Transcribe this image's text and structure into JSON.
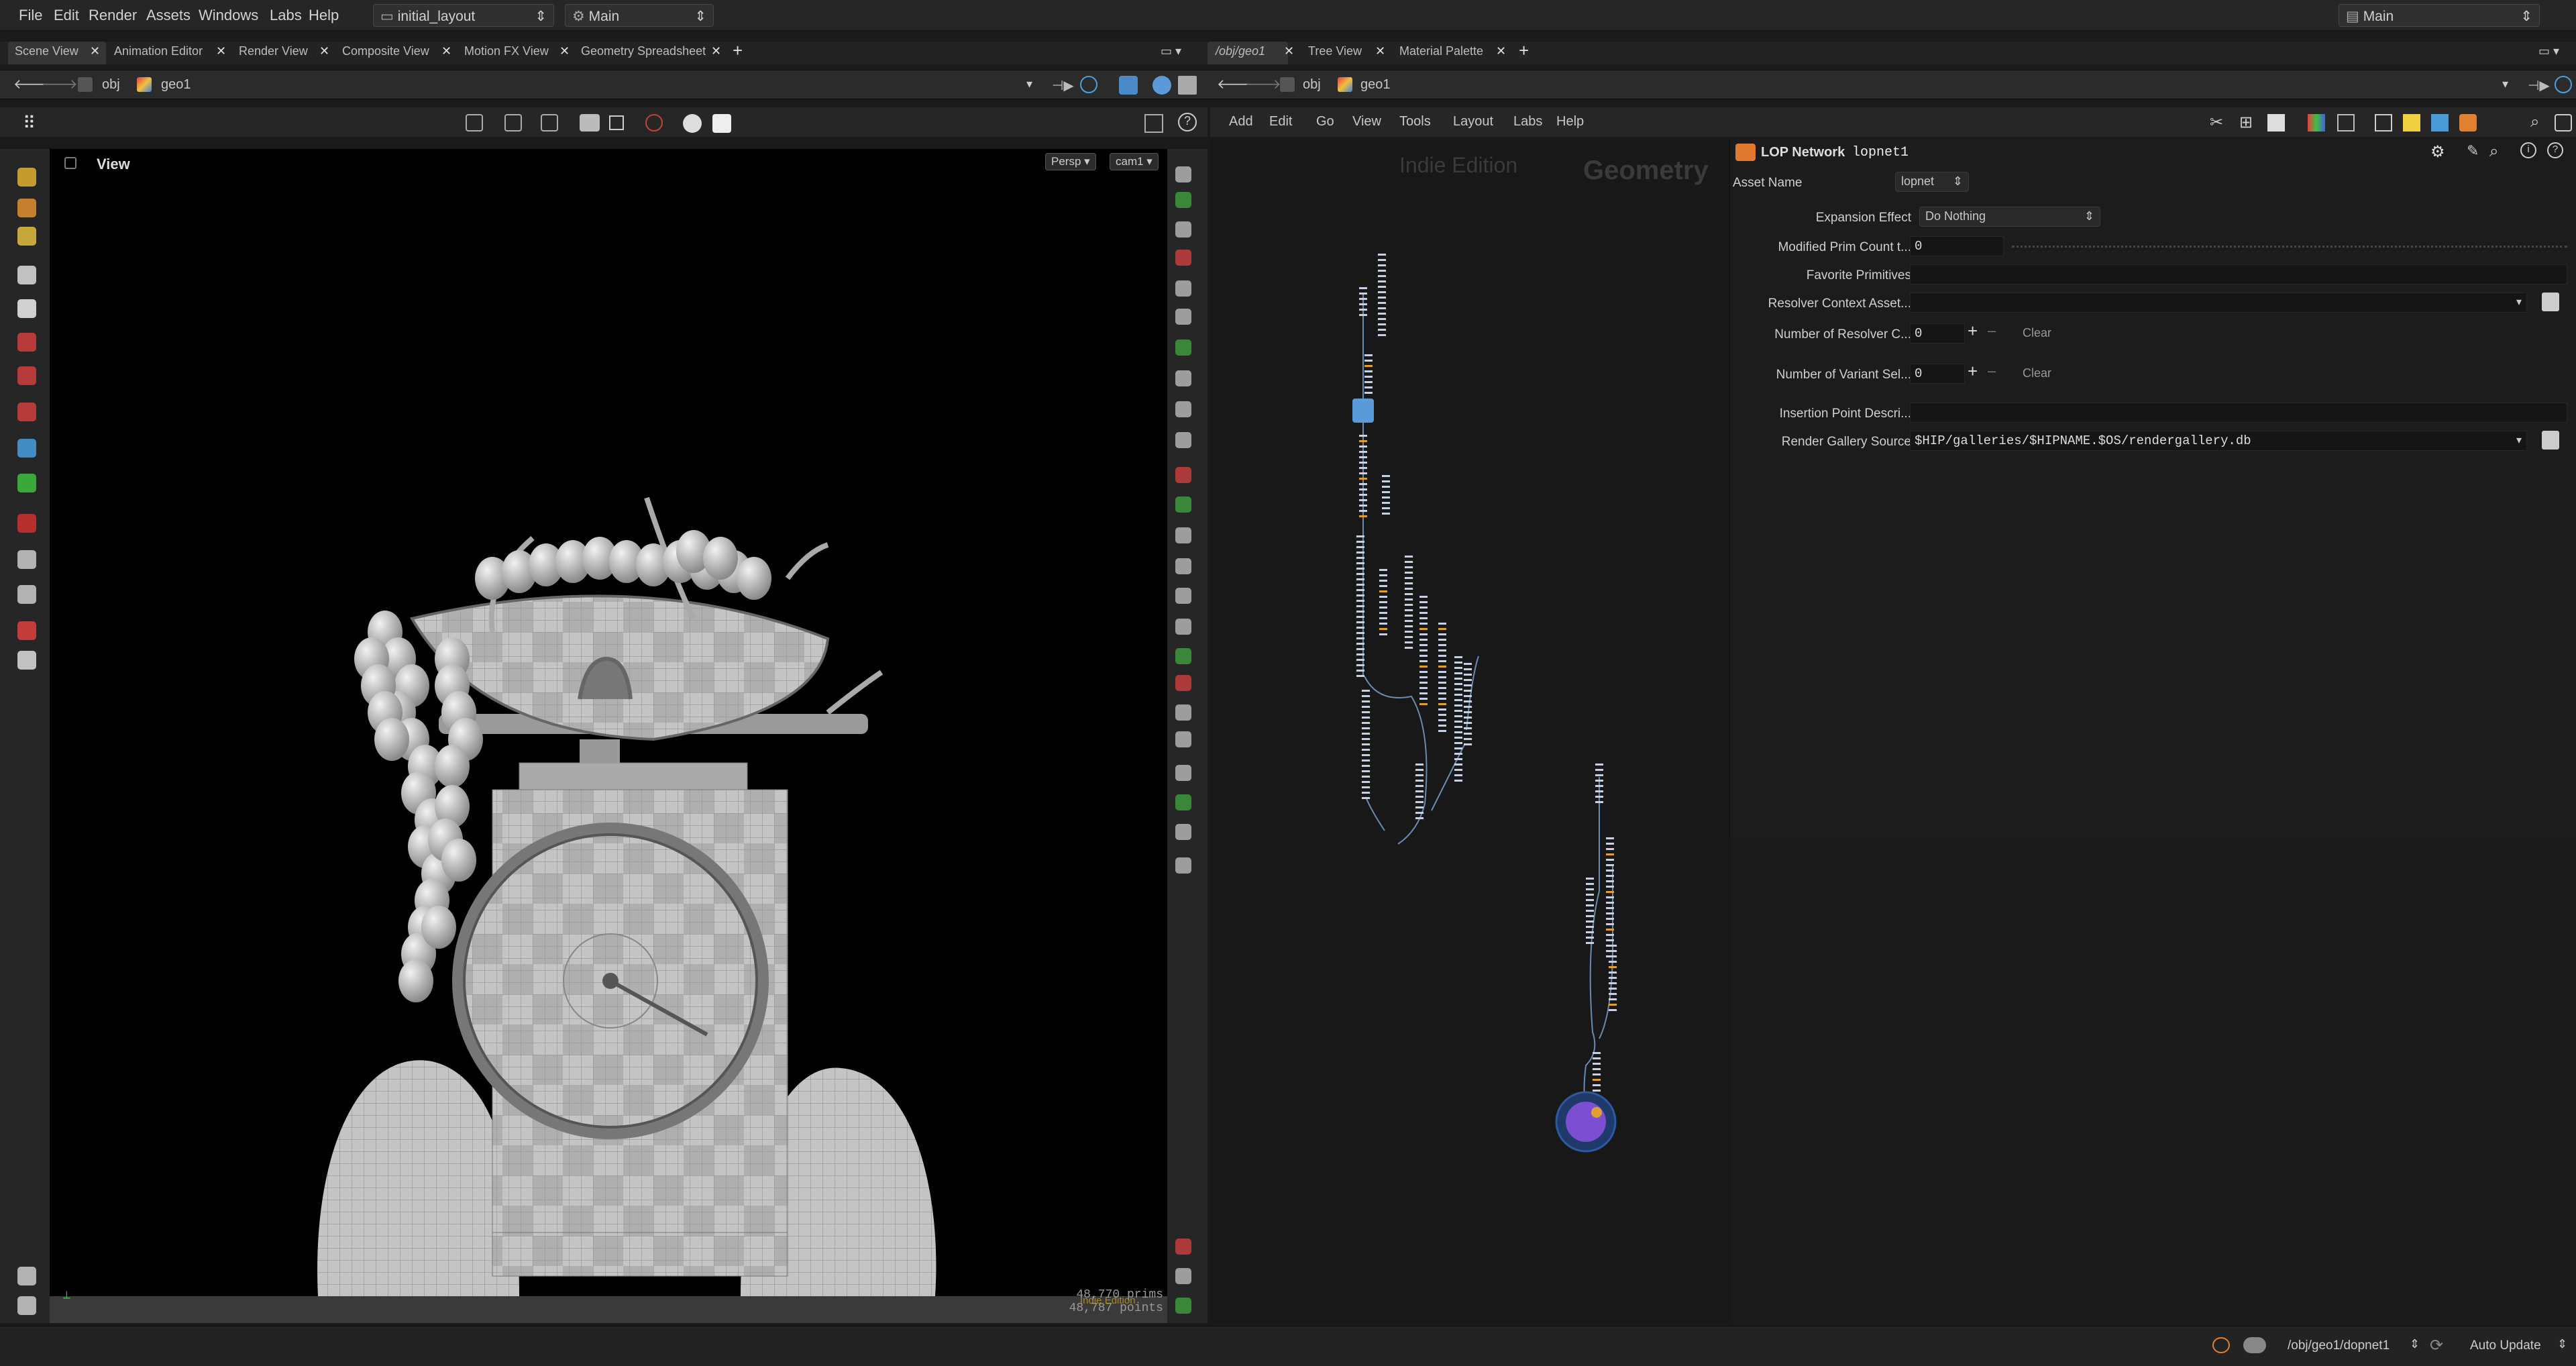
{
  "menubar": {
    "items": [
      "File",
      "Edit",
      "Render",
      "Assets",
      "Windows",
      "Labs",
      "Help"
    ],
    "desktop": "initial_layout",
    "context": "Main",
    "right_context": "Main"
  },
  "left_tabs": [
    "Scene View",
    "Animation Editor",
    "Render View",
    "Composite View",
    "Motion FX View",
    "Geometry Spreadsheet"
  ],
  "right_tabs": [
    "/obj/geo1",
    "Tree View",
    "Material Palette"
  ],
  "left_path": {
    "root": "obj",
    "node": "geo1"
  },
  "right_path": {
    "root": "obj",
    "node": "geo1"
  },
  "viewport": {
    "title": "View",
    "camera_mode": "Persp",
    "camera": "cam1",
    "prims": "48,770  prims",
    "points": "48,787  points",
    "watermark": "Indie Edition"
  },
  "network_menu": [
    "Add",
    "Edit",
    "Go",
    "View",
    "Tools",
    "Layout",
    "Labs",
    "Help"
  ],
  "network_watermarks": {
    "edition": "Indie Edition",
    "context": "Geometry"
  },
  "parms": {
    "node_type": "LOP Network",
    "node_name": "lopnet1",
    "asset_name_label": "Asset Name",
    "asset_name_value": "lopnet",
    "rows": [
      {
        "label": "Expansion Effect",
        "value": "Do Nothing"
      },
      {
        "label": "Modified Prim Count t...",
        "value": "0"
      },
      {
        "label": "Favorite Primitives",
        "value": ""
      },
      {
        "label": "Resolver Context Asset...",
        "value": ""
      },
      {
        "label": "Number of Resolver C...",
        "value": "0"
      },
      {
        "label": "Number of Variant Sel...",
        "value": "0"
      },
      {
        "label": "Insertion Point Descri...",
        "value": ""
      },
      {
        "label": "Render Gallery Source",
        "value": "$HIP/galleries/$HIPNAME.$OS/rendergallery.db"
      }
    ],
    "clear_label": "Clear"
  },
  "status": {
    "path": "/obj/geo1/dopnet1",
    "update": "Auto Update"
  },
  "colors": {
    "accent": "#f0a030",
    "node_purple": "#7b4fd0",
    "node_blue": "#4a86c8"
  }
}
